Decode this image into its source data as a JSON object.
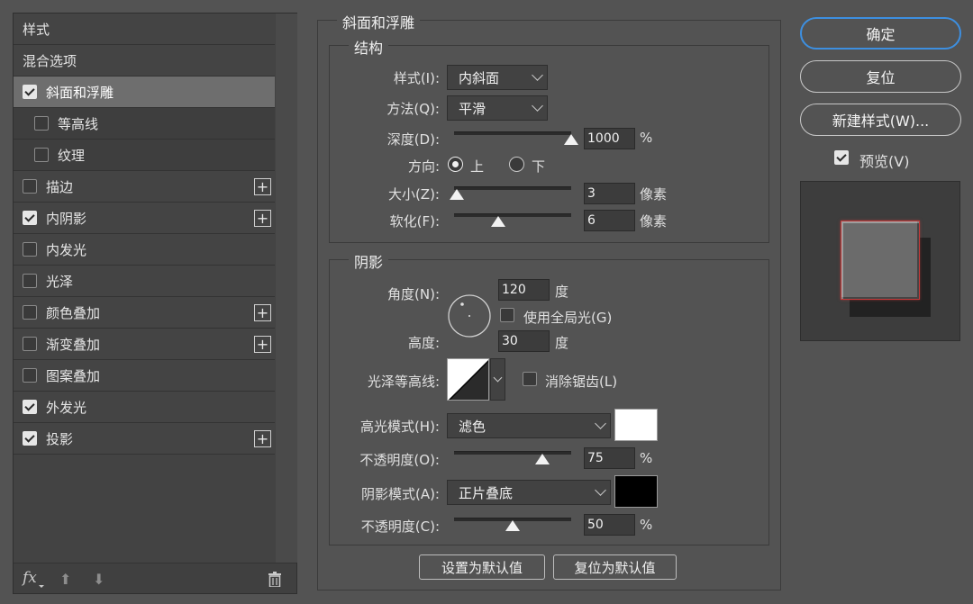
{
  "styles_list": {
    "items": [
      {
        "label": "样式",
        "checkbox": false,
        "checked": false,
        "indent": false,
        "plus": false,
        "selected": false
      },
      {
        "label": "混合选项",
        "checkbox": false,
        "checked": false,
        "indent": false,
        "plus": false,
        "selected": false
      },
      {
        "label": "斜面和浮雕",
        "checkbox": true,
        "checked": true,
        "indent": false,
        "plus": false,
        "selected": true
      },
      {
        "label": "等高线",
        "checkbox": true,
        "checked": false,
        "indent": true,
        "plus": false,
        "selected": false
      },
      {
        "label": "纹理",
        "checkbox": true,
        "checked": false,
        "indent": true,
        "plus": false,
        "selected": false
      },
      {
        "label": "描边",
        "checkbox": true,
        "checked": false,
        "indent": false,
        "plus": true,
        "selected": false
      },
      {
        "label": "内阴影",
        "checkbox": true,
        "checked": true,
        "indent": false,
        "plus": true,
        "selected": false
      },
      {
        "label": "内发光",
        "checkbox": true,
        "checked": false,
        "indent": false,
        "plus": false,
        "selected": false
      },
      {
        "label": "光泽",
        "checkbox": true,
        "checked": false,
        "indent": false,
        "plus": false,
        "selected": false
      },
      {
        "label": "颜色叠加",
        "checkbox": true,
        "checked": false,
        "indent": false,
        "plus": true,
        "selected": false
      },
      {
        "label": "渐变叠加",
        "checkbox": true,
        "checked": false,
        "indent": false,
        "plus": true,
        "selected": false
      },
      {
        "label": "图案叠加",
        "checkbox": true,
        "checked": false,
        "indent": false,
        "plus": false,
        "selected": false
      },
      {
        "label": "外发光",
        "checkbox": true,
        "checked": true,
        "indent": false,
        "plus": false,
        "selected": false
      },
      {
        "label": "投影",
        "checkbox": true,
        "checked": true,
        "indent": false,
        "plus": true,
        "selected": false
      }
    ],
    "footer": {
      "fx_label": "fx",
      "icons": [
        "fx-menu-icon",
        "move-up-icon",
        "move-down-icon",
        "trash-icon"
      ]
    }
  },
  "bevel": {
    "title": "斜面和浮雕",
    "structure": {
      "title": "结构",
      "style_label": "样式(I):",
      "style_value": "内斜面",
      "technique_label": "方法(Q):",
      "technique_value": "平滑",
      "depth_label": "深度(D):",
      "depth_value": "1000",
      "depth_unit": "%",
      "depth_fraction": 1.0,
      "direction_label": "方向:",
      "direction_up": "上",
      "direction_down": "下",
      "direction_selected": "上",
      "size_label": "大小(Z):",
      "size_value": "3",
      "size_unit": "像素",
      "size_fraction": 0.02,
      "soften_label": "软化(F):",
      "soften_value": "6",
      "soften_unit": "像素",
      "soften_fraction": 0.375
    },
    "shading": {
      "title": "阴影",
      "angle_label": "角度(N):",
      "angle_value": "120",
      "angle_unit": "度",
      "global_light_label": "使用全局光(G)",
      "global_light_checked": false,
      "altitude_label": "高度:",
      "altitude_value": "30",
      "altitude_unit": "度",
      "gloss_contour_label": "光泽等高线:",
      "anti_alias_label": "消除锯齿(L)",
      "anti_alias_checked": false,
      "highlight_mode_label": "高光模式(H):",
      "highlight_mode_value": "滤色",
      "highlight_color": "#ffffff",
      "highlight_opacity_label": "不透明度(O):",
      "highlight_opacity_value": "75",
      "highlight_opacity_unit": "%",
      "highlight_opacity_fraction": 0.75,
      "shadow_mode_label": "阴影模式(A):",
      "shadow_mode_value": "正片叠底",
      "shadow_color": "#000000",
      "shadow_opacity_label": "不透明度(C):",
      "shadow_opacity_value": "50",
      "shadow_opacity_unit": "%",
      "shadow_opacity_fraction": 0.5
    },
    "make_default_label": "设置为默认值",
    "reset_default_label": "复位为默认值"
  },
  "actions": {
    "ok_label": "确定",
    "reset_label": "复位",
    "new_style_label": "新建样式(W)...",
    "preview_label": "预览(V)",
    "preview_checked": true
  },
  "colors": {
    "background": "#535353",
    "panel": "#434343",
    "selected_row": "#6e6e6e",
    "accent_border": "#3d8fe0",
    "preview_square": "#6b6b6b",
    "preview_outline": "#c43a3a"
  }
}
